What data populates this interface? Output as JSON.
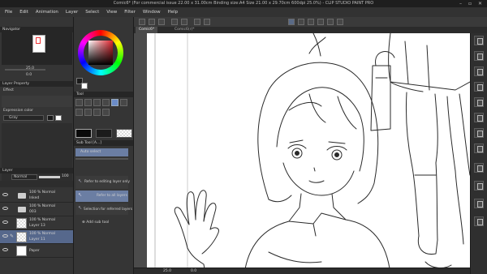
{
  "window": {
    "title": "Comic6* (For commercial issue 22.00 x 31.00cm Binding size:A4 Size 21.00 x 29.70cm 600dpi 25.0%) - CLIP STUDIO PAINT PRO"
  },
  "menu": [
    "File",
    "Edit",
    "Animation",
    "Layer",
    "Select",
    "View",
    "Filter",
    "Window",
    "Help"
  ],
  "tabs": [
    {
      "label": "Comic6*",
      "active": true
    },
    {
      "label": "Comic6(r)*",
      "active": false
    }
  ],
  "navigator": {
    "title": "Navigator",
    "zoom": "25.0",
    "angle": "0.0"
  },
  "layer_property": {
    "title": "Layer Property",
    "effect_label": "Effect",
    "expression_label": "Expression color",
    "expression_value": "Gray"
  },
  "color": {
    "current": "#1a1a1a",
    "accent": "#6b8cc8"
  },
  "tool": {
    "title": "Tool"
  },
  "sub_tool": {
    "title": "Sub Tool [A...]",
    "items": [
      {
        "label": "Auto select",
        "selected": true
      },
      {
        "label": "Refer to editing layer only",
        "selected": false
      },
      {
        "label": "Refer to all layers",
        "selected": true
      },
      {
        "label": "Selection for referred layers",
        "selected": false
      }
    ],
    "add_label": "Add sub tool"
  },
  "layer_panel": {
    "title": "Layer",
    "blend_mode": "Normal",
    "opacity": "100",
    "layers": [
      {
        "line1": "100 % Normal",
        "line2": "Inked",
        "type": "folder",
        "selected": false
      },
      {
        "line1": "100 % Normal",
        "line2": "003",
        "type": "folder",
        "selected": false
      },
      {
        "line1": "100 % Normal",
        "line2": "Layer 13",
        "type": "raster",
        "selected": false
      },
      {
        "line1": "100 % Normal",
        "line2": "Layer 11",
        "type": "raster",
        "selected": true
      },
      {
        "line1": "",
        "line2": "Paper",
        "type": "paper",
        "selected": false
      }
    ]
  },
  "status": {
    "zoom": "25.0"
  }
}
